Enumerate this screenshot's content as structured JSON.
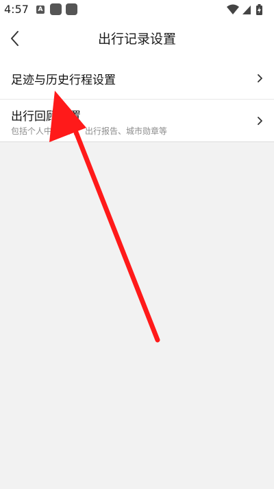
{
  "status_bar": {
    "time": "4:57",
    "notification_badge": "A",
    "icons": [
      "notification-a-icon",
      "app-square-icon",
      "app-square-icon",
      "wifi-icon",
      "cellular-signal-icon",
      "battery-charging-icon"
    ]
  },
  "header": {
    "back_icon": "chevron-left-icon",
    "title": "出行记录设置"
  },
  "settings": [
    {
      "title": "足迹与历史行程设置",
      "subtitle": "",
      "icon": "chevron-right-icon"
    },
    {
      "title": "出行回顾设置",
      "subtitle": "包括个人中心卡片、出行报告、城市勋章等",
      "icon": "chevron-right-icon"
    }
  ],
  "annotation": {
    "type": "arrow",
    "color": "#ff1a1a"
  },
  "colors": {
    "background": "#f2f2f2",
    "surface": "#ffffff",
    "subtitle_text": "#8c8c8c",
    "arrow": "#ff1a1a"
  }
}
